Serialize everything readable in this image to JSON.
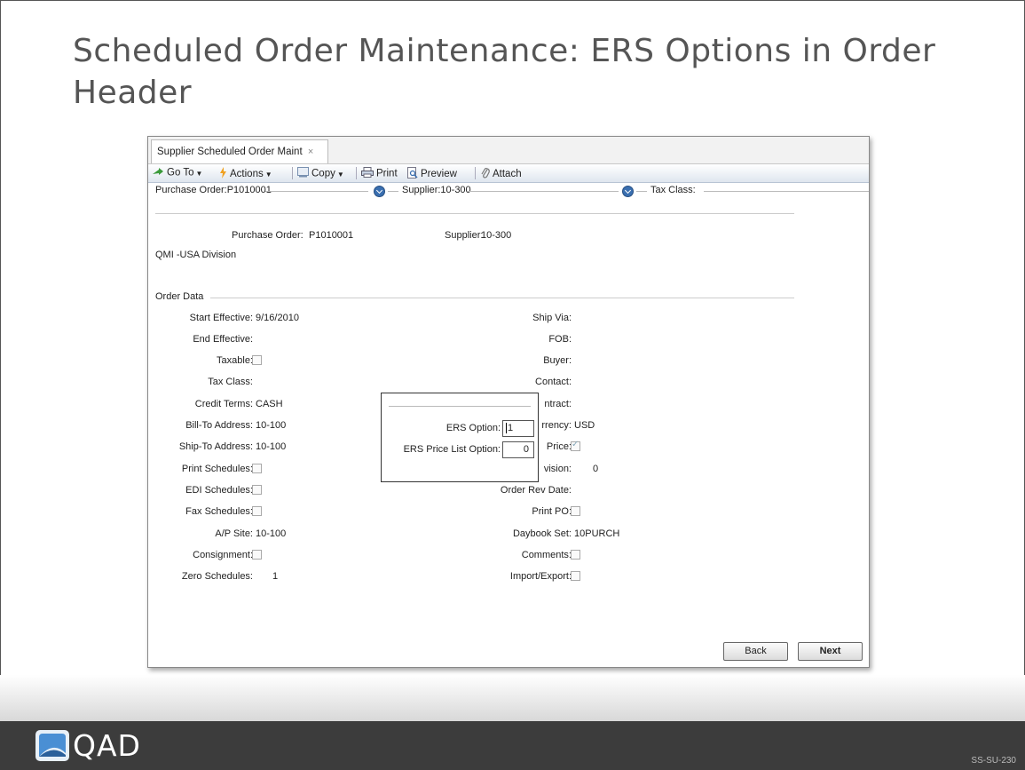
{
  "slide": {
    "title": "Scheduled Order Maintenance: ERS Options in Order Header",
    "logo_text": "QAD",
    "slide_code": "SS-SU-230"
  },
  "window": {
    "tab_label": "Supplier Scheduled Order Maint",
    "tab_close": "×"
  },
  "toolbar": {
    "goto": "Go To",
    "actions": "Actions",
    "copy": "Copy",
    "print": "Print",
    "preview": "Preview",
    "attach": "Attach"
  },
  "header": {
    "purchase_order": "Purchase Order:P1010001",
    "supplier": "Supplier:10-300",
    "tax_class": "Tax Class:"
  },
  "summary": {
    "po_label": "Purchase Order:",
    "po_value": "P1010001",
    "supplier_label": "Supplier:",
    "supplier_value": "10-300",
    "division": "QMI -USA Division"
  },
  "order_data": {
    "section_label": "Order Data",
    "start_effective_label": "Start Effective:",
    "start_effective_value": "9/16/2010",
    "end_effective_label": "End Effective:",
    "taxable_label": "Taxable:",
    "tax_class_label": "Tax Class:",
    "credit_terms_label": "Credit Terms:",
    "credit_terms_value": "CASH",
    "bill_to_label": "Bill-To Address:",
    "bill_to_value": "10-100",
    "ship_to_label": "Ship-To Address:",
    "ship_to_value": "10-100",
    "print_schedules_label": "Print Schedules:",
    "edi_schedules_label": "EDI Schedules:",
    "fax_schedules_label": "Fax Schedules:",
    "ap_site_label": "A/P Site:",
    "ap_site_value": "10-100",
    "consignment_label": "Consignment:",
    "zero_schedules_label": "Zero Schedules:",
    "zero_schedules_value": "1",
    "ship_via_label": "Ship Via:",
    "fob_label": "FOB:",
    "buyer_label": "Buyer:",
    "contact_label": "Contact:",
    "contract_label": "ntract:",
    "currency_label": "rrency:",
    "currency_value": "USD",
    "price_label": "Price:",
    "revision_label": "vision:",
    "revision_value": "0",
    "order_rev_date_label": "Order Rev Date:",
    "print_po_label": "Print PO:",
    "daybook_set_label": "Daybook Set:",
    "daybook_set_value": "10PURCH",
    "comments_label": "Comments:",
    "import_export_label": "Import/Export:"
  },
  "ers_popup": {
    "ers_option_label": "ERS Option:",
    "ers_option_value": "1",
    "ers_price_list_label": "ERS Price List Option:",
    "ers_price_list_value": "0"
  },
  "buttons": {
    "back": "Back",
    "next": "Next"
  }
}
